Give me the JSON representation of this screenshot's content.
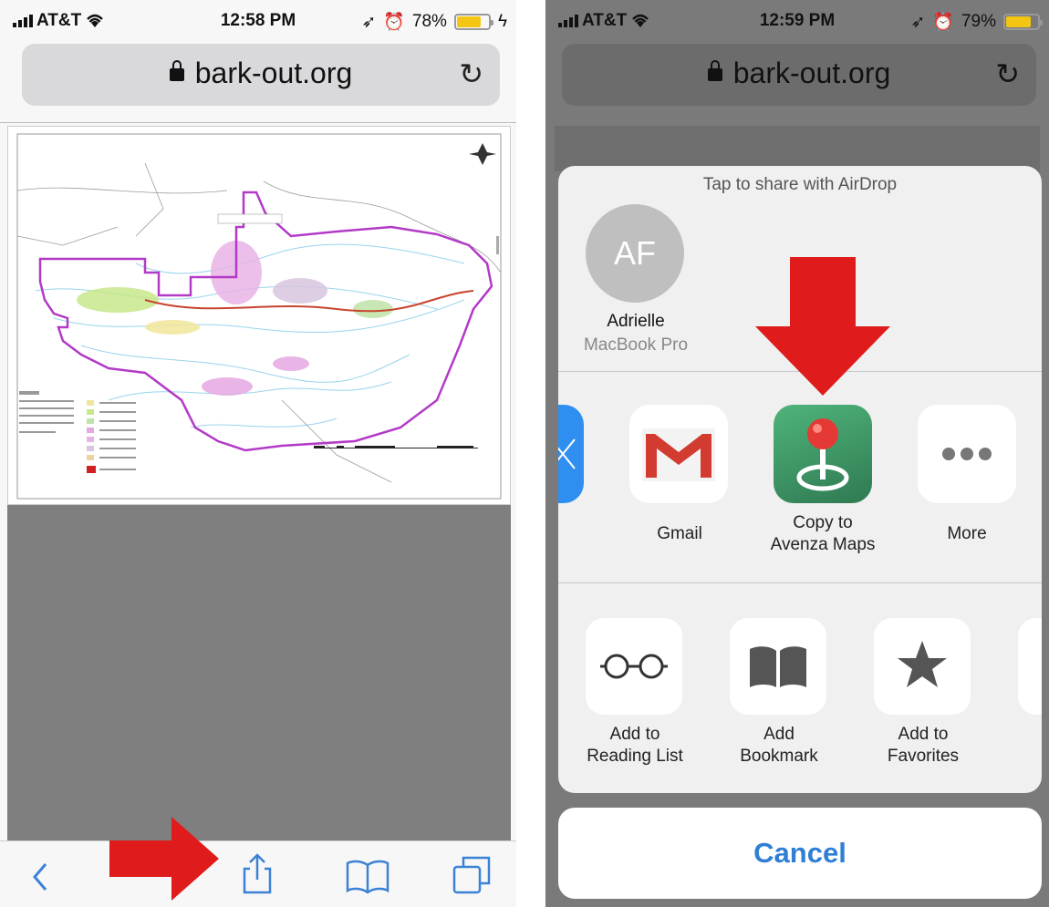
{
  "left": {
    "status": {
      "carrier": "AT&T",
      "time": "12:58 PM",
      "battery": "78%",
      "battery_level": 0.78
    },
    "url": "bark-out.org"
  },
  "right": {
    "status": {
      "carrier": "AT&T",
      "time": "12:59 PM",
      "battery": "79%",
      "battery_level": 0.79
    },
    "url": "bark-out.org",
    "share_sheet": {
      "airdrop_title": "Tap to share with AirDrop",
      "contact": {
        "initials": "AF",
        "name": "Adrielle",
        "device": "MacBook Pro"
      },
      "apps": [
        {
          "label": "Gmail",
          "icon": "gmail-icon"
        },
        {
          "label_line1": "Copy to",
          "label_line2": "Avenza Maps",
          "icon": "avenza-maps-icon"
        },
        {
          "label": "More",
          "icon": "more-icon"
        }
      ],
      "actions": [
        {
          "label_line1": "Add to",
          "label_line2": "Reading List",
          "icon": "reading-list-icon"
        },
        {
          "label_line1": "Add",
          "label_line2": "Bookmark",
          "icon": "bookmark-icon"
        },
        {
          "label_line1": "Add to",
          "label_line2": "Favorites",
          "icon": "star-icon"
        }
      ],
      "cancel": "Cancel"
    }
  },
  "colors": {
    "accent": "#2f7fd4",
    "arrow": "#e01b1b",
    "battery": "#f3c614",
    "map_border": "#b23ac7"
  }
}
